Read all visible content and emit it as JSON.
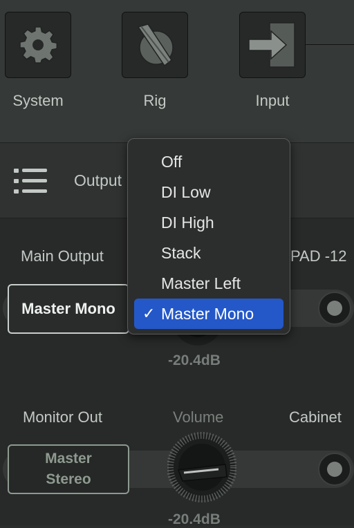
{
  "toolbar": {
    "items": [
      {
        "label": "System",
        "icon": "gear-icon"
      },
      {
        "label": "Rig",
        "icon": "rig-icon"
      },
      {
        "label": "Input",
        "icon": "input-arrow-icon"
      }
    ]
  },
  "section": {
    "title": "Output",
    "icon": "list-icon"
  },
  "main_output": {
    "label": "Main Output",
    "selected": "Master Mono",
    "pad_label": "PAD -12",
    "volume_value": "-20.4dB"
  },
  "monitor_out": {
    "label": "Monitor Out",
    "selected": "Master Stereo",
    "volume_label": "Volume",
    "volume_value": "-20.4dB",
    "cabinet_label": "Cabinet"
  },
  "dropdown": {
    "options": [
      "Off",
      "DI Low",
      "DI High",
      "Stack",
      "Master Left",
      "Master Mono"
    ],
    "selected_index": 5,
    "check_mark": "✓"
  },
  "colors": {
    "accent": "#2458c8",
    "panel": "#353937",
    "background": "#282a29"
  }
}
